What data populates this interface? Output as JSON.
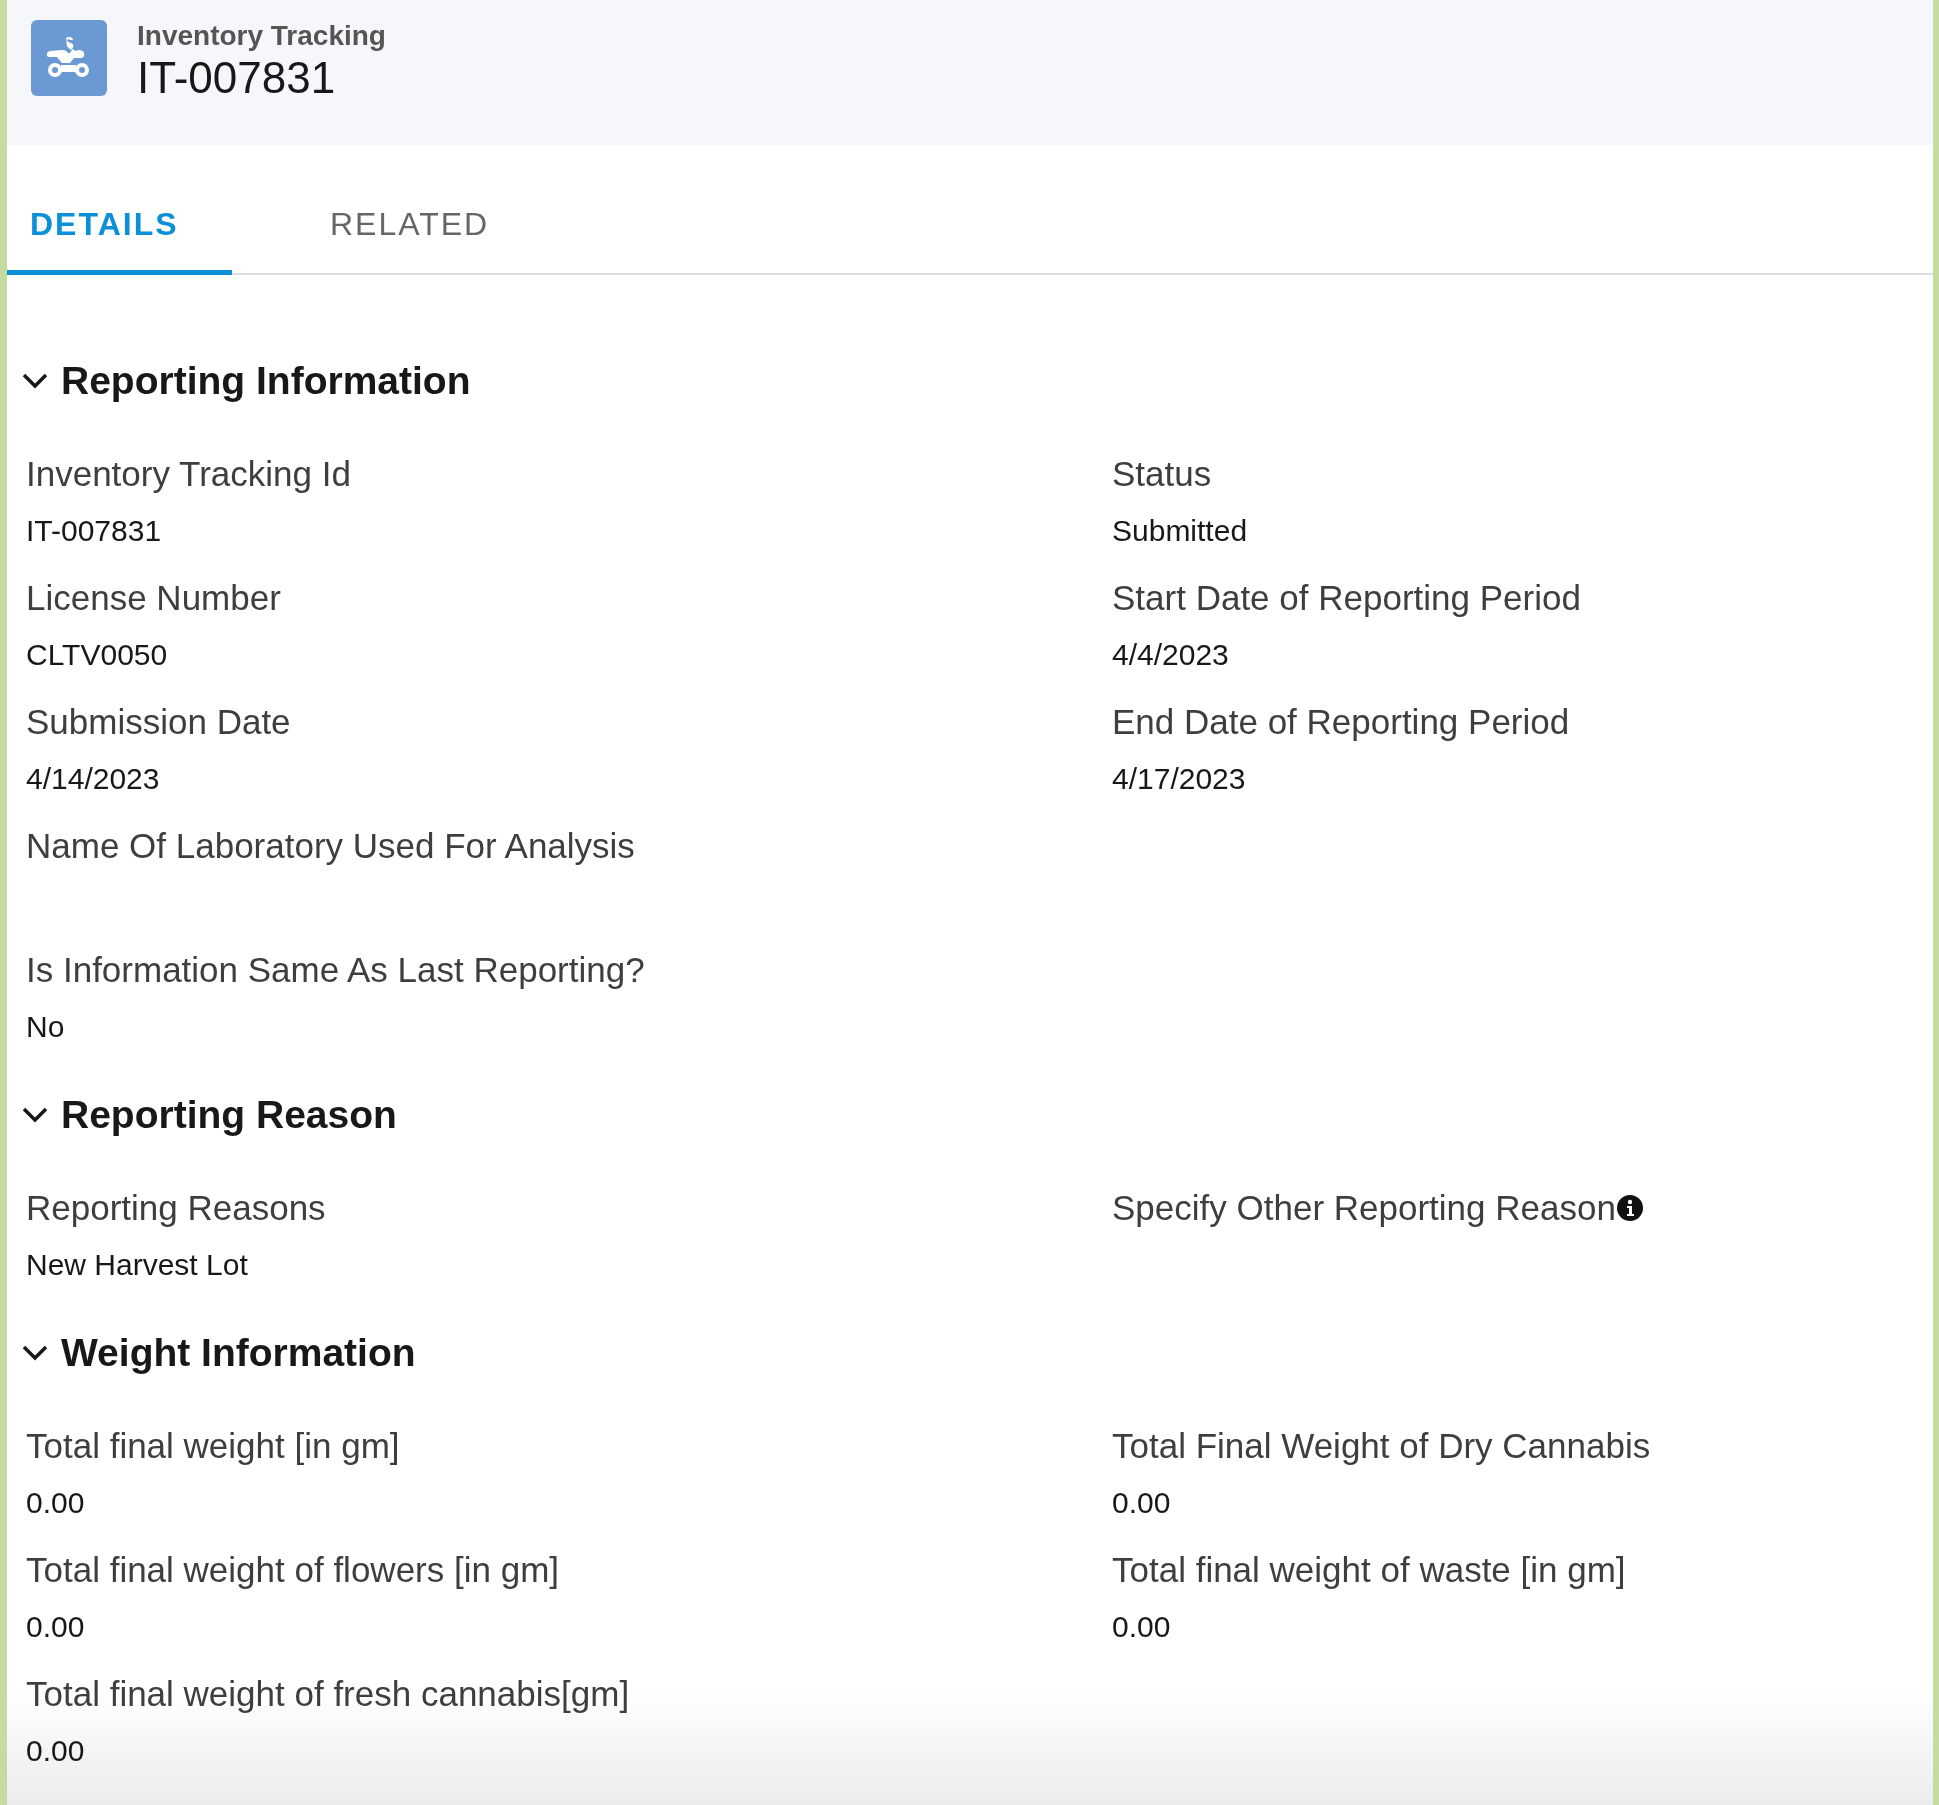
{
  "header": {
    "object_type": "Inventory Tracking",
    "record_name": "IT-007831"
  },
  "tabs": [
    {
      "label": "DETAILS",
      "selected": true
    },
    {
      "label": "RELATED",
      "selected": false
    }
  ],
  "sections": [
    {
      "title": "Reporting Information",
      "expanded": true,
      "rows": [
        {
          "cells": [
            {
              "label": "Inventory Tracking Id",
              "value": "IT-007831"
            },
            {
              "label": "Status",
              "value": "Submitted"
            }
          ]
        },
        {
          "cells": [
            {
              "label": "License Number",
              "value": "CLTV0050"
            },
            {
              "label": "Start Date of Reporting Period",
              "value": "4/4/2023"
            }
          ]
        },
        {
          "cells": [
            {
              "label": "Submission Date",
              "value": "4/14/2023"
            },
            {
              "label": "End Date of Reporting Period",
              "value": "4/17/2023"
            }
          ]
        },
        {
          "cells": [
            {
              "label": "Name Of Laboratory Used For Analysis"
            }
          ]
        },
        {
          "cells": [
            {
              "label": "Is Information Same As Last Reporting?",
              "value": "No"
            }
          ]
        }
      ]
    },
    {
      "title": "Reporting Reason",
      "expanded": true,
      "rows": [
        {
          "cells": [
            {
              "label": "Reporting Reasons",
              "value": "New Harvest Lot"
            },
            {
              "label": "Specify Other Reporting Reason",
              "info": true
            }
          ]
        }
      ]
    },
    {
      "title": "Weight Information",
      "expanded": true,
      "rows": [
        {
          "cells": [
            {
              "label": "Total final weight [in gm]",
              "value": "0.00"
            },
            {
              "label": "Total Final Weight of Dry Cannabis",
              "value": "0.00"
            }
          ]
        },
        {
          "cells": [
            {
              "label": "Total final weight of flowers [in gm]",
              "value": "0.00"
            },
            {
              "label": "Total final weight of waste [in gm]",
              "value": "0.00"
            }
          ]
        },
        {
          "cells": [
            {
              "label": "Total final weight of fresh cannabis[gm]",
              "value": "0.00"
            }
          ]
        }
      ]
    }
  ]
}
